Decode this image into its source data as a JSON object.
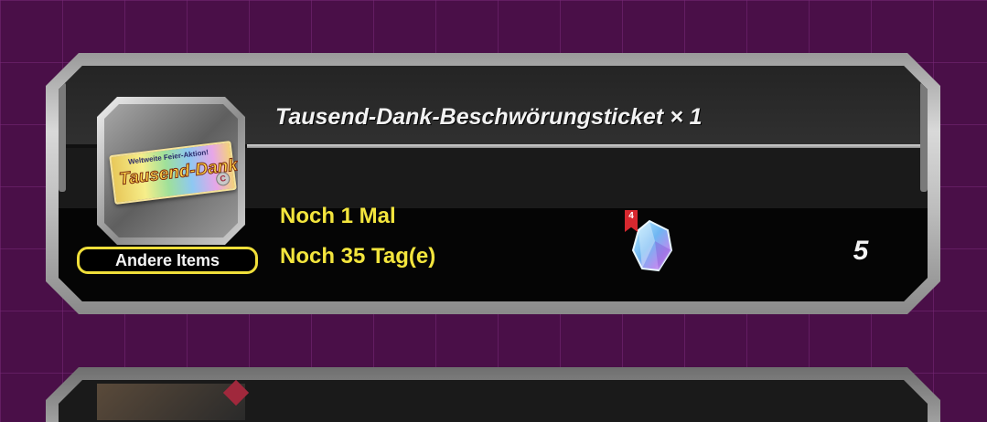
{
  "reward": {
    "title": "Tausend-Dank-Beschwörungsticket × 1",
    "ticket_top_text": "Weltweite Feier-Aktion!",
    "ticket_main_text": "Tausend-Dank",
    "ticket_badge": "C",
    "category_label": "Andere Items",
    "count_text": "Noch 1 Mal",
    "days_text": "Noch 35 Tag(e)",
    "crystal_badge": "4",
    "amount": "5"
  },
  "colors": {
    "background": "#4a0f48",
    "accent_yellow": "#f3e53d",
    "title_text": "#f2f2f2",
    "badge_red": "#d7282f"
  },
  "icons": {
    "crystal": "dragon-stone-icon",
    "flag": "red-flag-badge-icon"
  }
}
